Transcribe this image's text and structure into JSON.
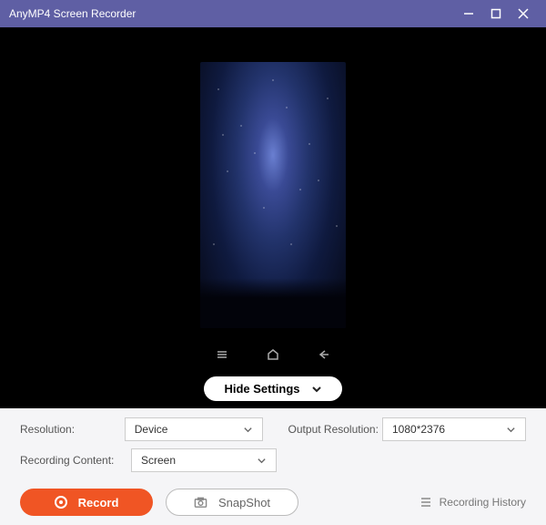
{
  "titlebar": {
    "app_title": "AnyMP4 Screen Recorder"
  },
  "preview": {
    "hide_settings_label": "Hide Settings"
  },
  "settings": {
    "resolution_label": "Resolution:",
    "resolution_value": "Device",
    "recording_content_label": "Recording Content:",
    "recording_content_value": "Screen",
    "output_resolution_label": "Output Resolution:",
    "output_resolution_value": "1080*2376"
  },
  "footer": {
    "record_label": "Record",
    "snapshot_label": "SnapShot",
    "recording_history_label": "Recording History"
  }
}
